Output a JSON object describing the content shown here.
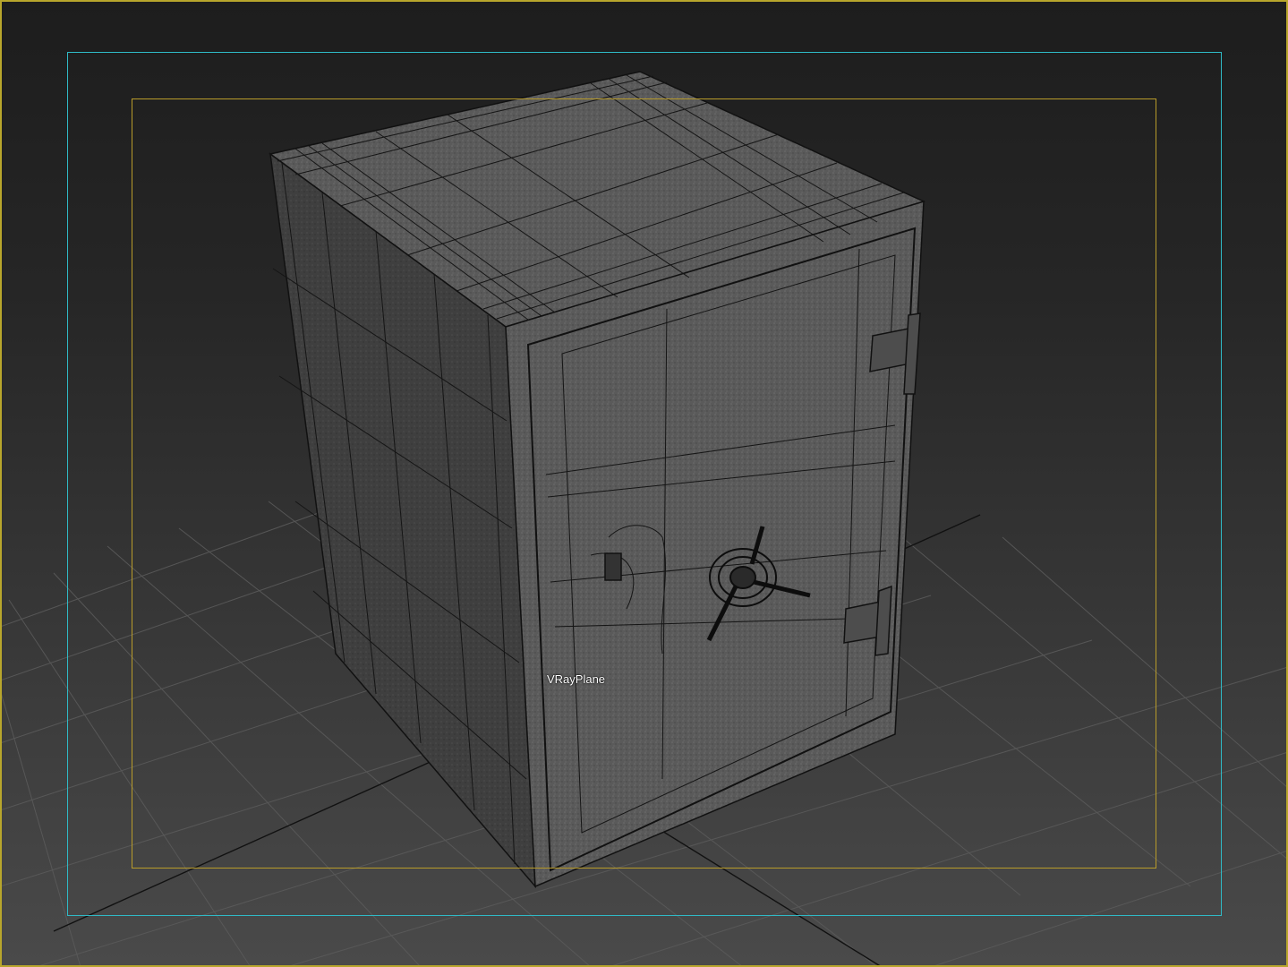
{
  "viewport": {
    "object_label": "VRayPlane",
    "colors": {
      "viewport_border": "#b8a62c",
      "safe_frame_action": "#2fbac6",
      "safe_frame_title": "#b89b2a",
      "grid_line": "#5a5a5a",
      "wireframe": "#111111",
      "surface": "#5e5e5e"
    }
  }
}
